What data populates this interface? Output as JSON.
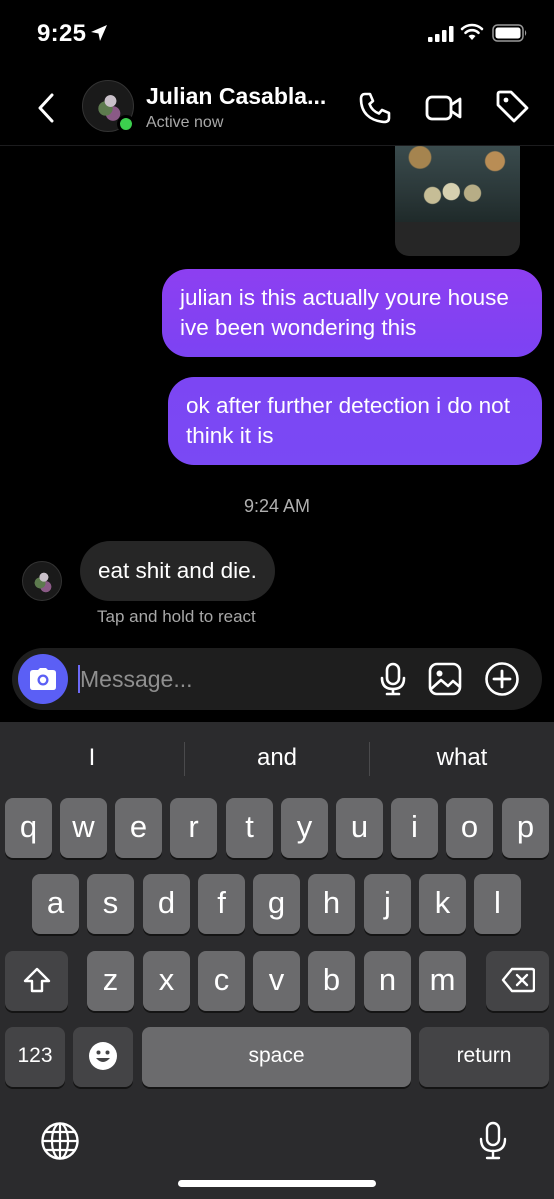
{
  "status_bar": {
    "time": "9:25",
    "icons": [
      "location-arrow-icon",
      "cellular-signal-icon",
      "wifi-icon",
      "battery-icon"
    ]
  },
  "header": {
    "contact_name": "Julian Casabla...",
    "status": "Active now",
    "online": true,
    "icons": [
      "back-chevron-icon",
      "phone-icon",
      "video-camera-icon",
      "tag-icon"
    ]
  },
  "conversation": {
    "messages": [
      {
        "direction": "outgoing",
        "type": "image"
      },
      {
        "direction": "outgoing",
        "text": "julian is this actually youre house ive been wondering this"
      },
      {
        "direction": "outgoing",
        "text": "ok after further detection i do not think it is"
      },
      {
        "direction": "incoming",
        "text": "eat shit and die."
      }
    ],
    "timestamp": "9:24 AM",
    "react_hint": "Tap and hold to react"
  },
  "composer": {
    "placeholder": "Message...",
    "value": "",
    "icons": [
      "camera-icon",
      "microphone-icon",
      "gallery-icon",
      "plus-circle-icon"
    ]
  },
  "keyboard": {
    "suggestions": [
      "I",
      "and",
      "what"
    ],
    "row1": [
      "q",
      "w",
      "e",
      "r",
      "t",
      "y",
      "u",
      "i",
      "o",
      "p"
    ],
    "row2": [
      "a",
      "s",
      "d",
      "f",
      "g",
      "h",
      "j",
      "k",
      "l"
    ],
    "row3": [
      "z",
      "x",
      "c",
      "v",
      "b",
      "n",
      "m"
    ],
    "numbers_label": "123",
    "space_label": "space",
    "return_label": "return",
    "icons": [
      "shift-icon",
      "backspace-icon",
      "emoji-icon",
      "globe-icon",
      "dictation-mic-icon"
    ]
  },
  "colors": {
    "outgoing_bubble": "#8a3cf0",
    "incoming_bubble": "#262626",
    "camera_button": "#5b5ff5",
    "online_dot": "#3ccf4e"
  }
}
